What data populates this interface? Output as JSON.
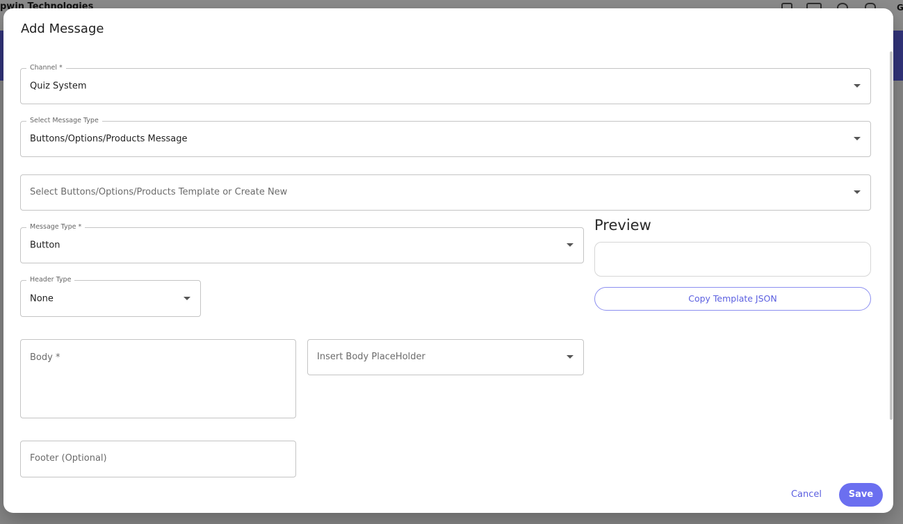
{
  "background": {
    "brand": "pwin Technologies",
    "corner_letter": "G"
  },
  "dialog": {
    "title": "Add Message",
    "channel": {
      "label": "Channel *",
      "value": "Quiz System"
    },
    "message_type_select": {
      "label": "Select Message Type",
      "value": "Buttons/Options/Products Message"
    },
    "template_select": {
      "placeholder": "Select Buttons/Options/Products Template or Create New"
    },
    "message_type": {
      "label": "Message Type *",
      "value": "Button"
    },
    "header_type": {
      "label": "Header Type",
      "value": "None"
    },
    "body": {
      "placeholder": "Body *"
    },
    "body_placeholder_select": {
      "placeholder": "Insert Body PlaceHolder"
    },
    "footer": {
      "placeholder": "Footer (Optional)"
    },
    "preview": {
      "title": "Preview",
      "copy_label": "Copy Template JSON"
    },
    "actions": {
      "cancel_label": "Cancel",
      "save_label": "Save"
    }
  },
  "colors": {
    "accent": "#5b5fe0",
    "save_button": "#6b6ff0"
  },
  "icons": [
    "dropdown-caret-icon",
    "fullscreen-icon",
    "toggle-icon",
    "gear-icon",
    "bell-icon"
  ]
}
